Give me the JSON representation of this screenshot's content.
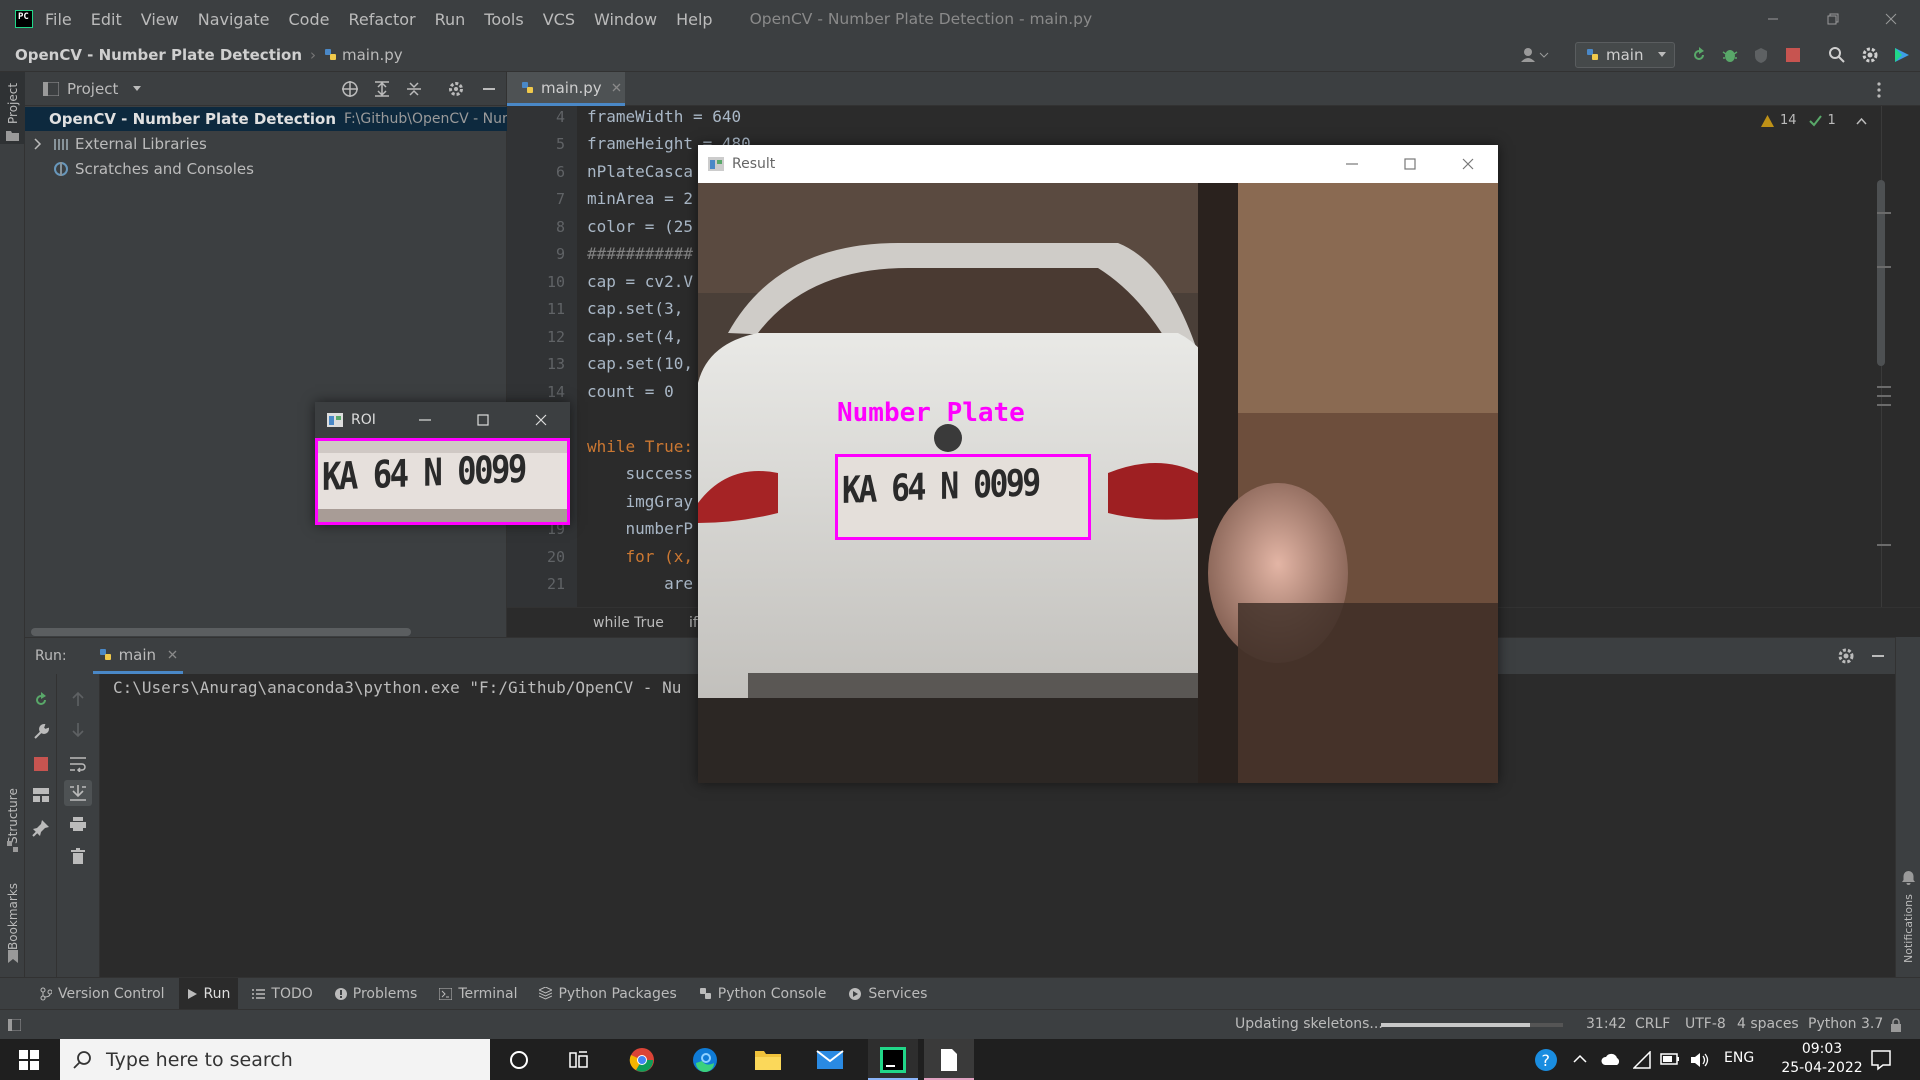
{
  "window": {
    "menus": [
      "File",
      "Edit",
      "View",
      "Navigate",
      "Code",
      "Refactor",
      "Run",
      "Tools",
      "VCS",
      "Window",
      "Help"
    ],
    "title": "OpenCV - Number Plate Detection - main.py"
  },
  "breadcrumb": {
    "project": "OpenCV - Number Plate Detection",
    "file": "main.py"
  },
  "run_config": {
    "label": "main"
  },
  "left_strip": {
    "project": "Project",
    "structure": "Structure",
    "bookmarks": "Bookmarks"
  },
  "project_panel": {
    "title": "Project",
    "tree": [
      {
        "label": "OpenCV - Number Plate Detection",
        "path": "F:\\Github\\OpenCV - Numbe"
      },
      {
        "label": "External Libraries"
      },
      {
        "label": "Scratches and Consoles"
      }
    ]
  },
  "editor": {
    "tab": "main.py",
    "inspections": {
      "warnings": "14",
      "ok": "1"
    },
    "lines": [
      {
        "n": "4",
        "code": "frameWidth = 640"
      },
      {
        "n": "5",
        "code": "frameHeight = 480"
      },
      {
        "n": "6",
        "code": "nPlateCasca"
      },
      {
        "n": "7",
        "code": "minArea = 2"
      },
      {
        "n": "8",
        "code": "color = (25"
      },
      {
        "n": "9",
        "code": "###########"
      },
      {
        "n": "10",
        "code": "cap = cv2.V"
      },
      {
        "n": "11",
        "code": "cap.set(3,"
      },
      {
        "n": "12",
        "code": "cap.set(4,"
      },
      {
        "n": "13",
        "code": "cap.set(10,"
      },
      {
        "n": "14",
        "code": "count = 0"
      },
      {
        "n": "15",
        "code": ""
      },
      {
        "n": "16",
        "code": "while True:"
      },
      {
        "n": "17",
        "code": "    success"
      },
      {
        "n": "18",
        "code": "    imgGray"
      },
      {
        "n": "19",
        "code": "    numberP"
      },
      {
        "n": "20",
        "code": "    for (x,"
      },
      {
        "n": "21",
        "code": "        are"
      }
    ],
    "breadcrumb": [
      "while True",
      "if"
    ]
  },
  "run_panel": {
    "label": "Run:",
    "tab": "main",
    "console": "C:\\Users\\Anurag\\anaconda3\\python.exe \"F:/Github/OpenCV - Nu"
  },
  "tool_tabs": [
    "Version Control",
    "Run",
    "TODO",
    "Problems",
    "Terminal",
    "Python Packages",
    "Python Console",
    "Services"
  ],
  "status": {
    "task": "Updating skeletons...",
    "progress": 0.82,
    "position": "31:42",
    "line_sep": "CRLF",
    "encoding": "UTF-8",
    "indent": "4 spaces",
    "interpreter": "Python 3.7"
  },
  "notifications_label": "Notifications",
  "roi_window": {
    "title": "ROI",
    "plate_text": "KA 64 N 0099"
  },
  "result_window": {
    "title": "Result",
    "label": "Number Plate",
    "plate_text": "KA 64 N 0099",
    "box_color": "#ff00ff"
  },
  "taskbar": {
    "search_placeholder": "Type here to search",
    "language": "ENG",
    "time": "09:03",
    "date": "25-04-2022"
  },
  "colors": {
    "accent": "#4a88c7",
    "ide_bg": "#2b2b2b",
    "panel_bg": "#3c3f41"
  }
}
